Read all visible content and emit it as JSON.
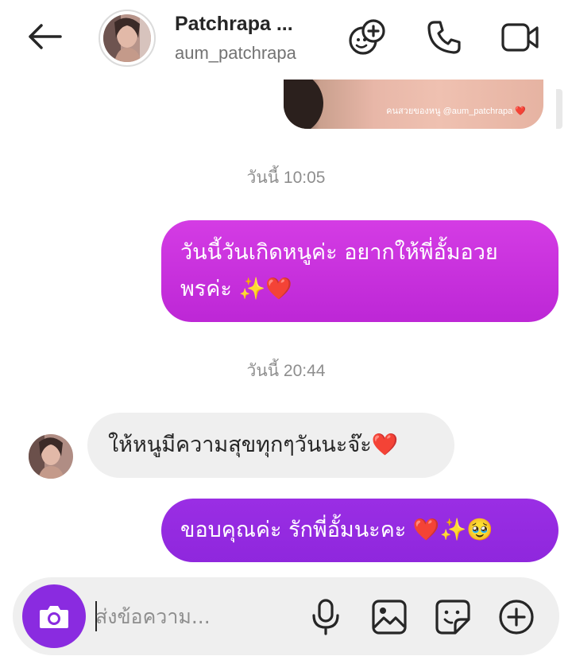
{
  "header": {
    "name": "Patchrapa ...",
    "username": "aum_patchrapa",
    "icons": [
      "back-arrow-icon",
      "add-friend-icon",
      "phone-icon",
      "video-icon"
    ]
  },
  "shared_image": {
    "caption": "คนสวยของหนู @aum_patchrapa ❤️"
  },
  "messages": [
    {
      "type": "timestamp",
      "text": "วันนี้ 10:05"
    },
    {
      "type": "outgoing",
      "line1": "วันนี้วันเกิดหนูค่ะ อยากให้พี่อั้มอวย",
      "line2": "พรค่ะ ✨❤️"
    },
    {
      "type": "timestamp",
      "text": "วันนี้ 20:44"
    },
    {
      "type": "incoming",
      "text": "ให้หนูมีความสุขทุกๆวันนะจ๊ะ❤️"
    },
    {
      "type": "outgoing",
      "text": "ขอบคุณค่ะ รักพี่อั้มนะคะ ❤️✨🥹"
    }
  ],
  "composer": {
    "placeholder": "ส่งข้อความ...",
    "icons": [
      "camera-icon",
      "microphone-icon",
      "gallery-icon",
      "sticker-icon",
      "plus-icon"
    ]
  },
  "colors": {
    "bubble_out_1": "#c930de",
    "bubble_out_2": "#9a2ee4",
    "bubble_in": "#efefef",
    "camera_button": "#8a2be0"
  }
}
